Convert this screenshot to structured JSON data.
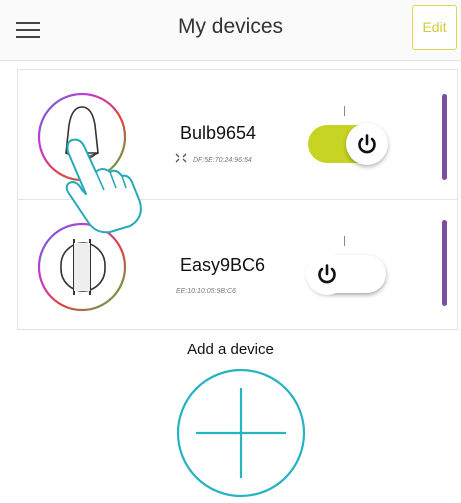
{
  "header": {
    "title": "My devices",
    "edit_label": "Edit",
    "menu_icon": "hamburger-menu-icon"
  },
  "devices": [
    {
      "name": "Bulb9654",
      "mac": "DF:5E:70:24:96:54",
      "power": "on",
      "icon": "bulb-icon",
      "signal_icon": "signal-icon"
    },
    {
      "name": "Easy9BC6",
      "mac": "EE:10:10:05:9B:C6",
      "power": "off",
      "icon": "lamp-icon"
    }
  ],
  "add_device": {
    "label": "Add a device",
    "icon": "plus-icon"
  },
  "colors": {
    "toggle_on": "#c8d424",
    "accent_bar": "#7b4fa0",
    "add_circle": "#27b3c2",
    "edit_border": "#e0d84a"
  }
}
